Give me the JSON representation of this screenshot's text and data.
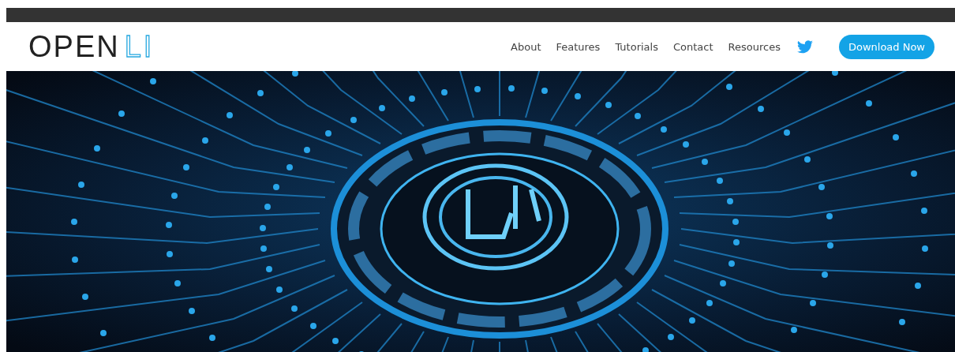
{
  "header": {
    "logo_text": "OPEN",
    "logo_mark": "LI"
  },
  "nav": {
    "links": [
      {
        "label": "About"
      },
      {
        "label": "Features"
      },
      {
        "label": "Tutorials"
      },
      {
        "label": "Contact"
      },
      {
        "label": "Resources"
      }
    ],
    "cta": "Download Now"
  }
}
